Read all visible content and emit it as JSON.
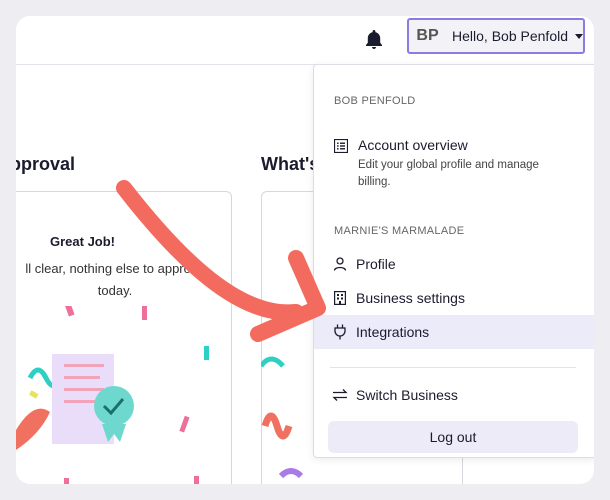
{
  "topbar": {
    "user_initials": "BP",
    "user_greeting": "Hello, Bob Penfold"
  },
  "main": {
    "approval_heading": "pproval",
    "whats_heading": "What's",
    "approval_card": {
      "title": "Great Job!",
      "text": "ll clear, nothing else to approve today."
    }
  },
  "dropdown": {
    "user_section_label": "BOB PENFOLD",
    "account_overview": {
      "label": "Account overview",
      "description": "Edit your global profile and manage billing."
    },
    "business_section_label": "MARNIE'S MARMALADE",
    "items": [
      {
        "label": "Profile",
        "icon": "user-icon"
      },
      {
        "label": "Business settings",
        "icon": "building-icon"
      },
      {
        "label": "Integrations",
        "icon": "plug-icon"
      }
    ],
    "switch_business": {
      "label": "Switch Business",
      "icon": "switch-arrows-icon"
    },
    "logout_label": "Log out"
  },
  "colors": {
    "accent": "#8a7ce0",
    "highlight": "#ecebfa",
    "arrow": "#f26b5e",
    "confetti_pink": "#ee6f9a",
    "confetti_teal": "#2fd0c4"
  }
}
